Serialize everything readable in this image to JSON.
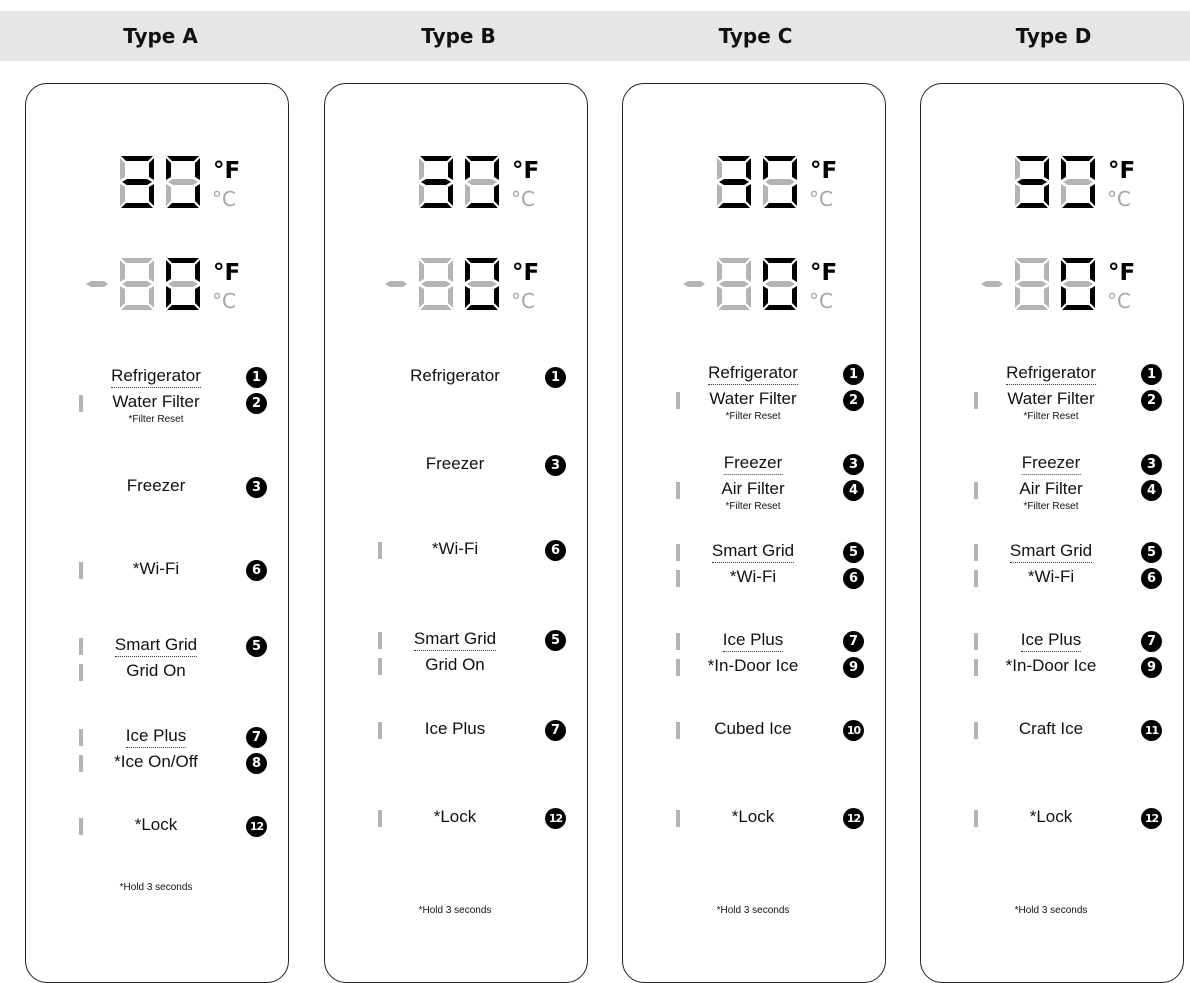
{
  "columns": [
    {
      "title": "Type A",
      "items": [
        {
          "label": "Refrigerator",
          "number": "1",
          "bar": false,
          "dotted": true,
          "row": 0
        },
        {
          "label": "Water Filter",
          "number": "2",
          "bar": true,
          "dotted": false,
          "row": 1,
          "sub": "*Filter Reset"
        },
        {
          "label": "Freezer",
          "number": "3",
          "bar": false,
          "dotted": false,
          "row": 2
        },
        {
          "label": "*Wi-Fi",
          "number": "6",
          "bar": true,
          "dotted": false,
          "row": 3
        },
        {
          "label": "Smart Grid",
          "number": "5",
          "bar": true,
          "dotted": true,
          "row": 4
        },
        {
          "label": "Grid On",
          "number": "",
          "bar": true,
          "dotted": false,
          "row": 5
        },
        {
          "label": "Ice Plus",
          "number": "7",
          "bar": true,
          "dotted": true,
          "row": 6
        },
        {
          "label": "*Ice On/Off",
          "number": "8",
          "bar": true,
          "dotted": false,
          "row": 7
        },
        {
          "label": "*Lock",
          "number": "12",
          "bar": true,
          "dotted": false,
          "row": 8
        }
      ],
      "note": "*Hold 3 seconds"
    },
    {
      "title": "Type B",
      "items": [
        {
          "label": "Refrigerator",
          "number": "1",
          "bar": false,
          "dotted": false,
          "row": 0
        },
        {
          "label": "Freezer",
          "number": "3",
          "bar": false,
          "dotted": false,
          "row": 2
        },
        {
          "label": "*Wi-Fi",
          "number": "6",
          "bar": true,
          "dotted": false,
          "row": 3
        },
        {
          "label": "Smart Grid",
          "number": "5",
          "bar": true,
          "dotted": true,
          "row": 4
        },
        {
          "label": "Grid On",
          "number": "",
          "bar": true,
          "dotted": false,
          "row": 5
        },
        {
          "label": "Ice Plus",
          "number": "7",
          "bar": true,
          "dotted": false,
          "row": 6
        },
        {
          "label": "*Lock",
          "number": "12",
          "bar": true,
          "dotted": false,
          "row": 8
        }
      ],
      "note": "*Hold 3 seconds"
    },
    {
      "title": "Type C",
      "items": [
        {
          "label": "Refrigerator",
          "number": "1",
          "bar": false,
          "dotted": true,
          "row": 0
        },
        {
          "label": "Water Filter",
          "number": "2",
          "bar": true,
          "dotted": false,
          "row": 1,
          "sub": "*Filter Reset"
        },
        {
          "label": "Freezer",
          "number": "3",
          "bar": false,
          "dotted": true,
          "row": 2
        },
        {
          "label": "Air Filter",
          "number": "4",
          "bar": true,
          "dotted": false,
          "row": 3,
          "sub": "*Filter Reset"
        },
        {
          "label": "Smart Grid",
          "number": "5",
          "bar": true,
          "dotted": true,
          "row": 4
        },
        {
          "label": "*Wi-Fi",
          "number": "6",
          "bar": true,
          "dotted": false,
          "row": 5
        },
        {
          "label": "Ice Plus",
          "number": "7",
          "bar": true,
          "dotted": true,
          "row": 6
        },
        {
          "label": "*In-Door Ice",
          "number": "9",
          "bar": true,
          "dotted": false,
          "row": 7
        },
        {
          "label": "Cubed Ice",
          "number": "10",
          "bar": true,
          "dotted": false,
          "row": 8
        },
        {
          "label": "*Lock",
          "number": "12",
          "bar": true,
          "dotted": false,
          "row": 9
        }
      ],
      "note": "*Hold 3 seconds"
    },
    {
      "title": "Type D",
      "items": [
        {
          "label": "Refrigerator",
          "number": "1",
          "bar": false,
          "dotted": true,
          "row": 0
        },
        {
          "label": "Water Filter",
          "number": "2",
          "bar": true,
          "dotted": false,
          "row": 1,
          "sub": "*Filter Reset"
        },
        {
          "label": "Freezer",
          "number": "3",
          "bar": false,
          "dotted": true,
          "row": 2
        },
        {
          "label": "Air Filter",
          "number": "4",
          "bar": true,
          "dotted": false,
          "row": 3,
          "sub": "*Filter Reset"
        },
        {
          "label": "Smart Grid",
          "number": "5",
          "bar": true,
          "dotted": true,
          "row": 4
        },
        {
          "label": "*Wi-Fi",
          "number": "6",
          "bar": true,
          "dotted": false,
          "row": 5
        },
        {
          "label": "Ice Plus",
          "number": "7",
          "bar": true,
          "dotted": true,
          "row": 6
        },
        {
          "label": "*In-Door Ice",
          "number": "9",
          "bar": true,
          "dotted": false,
          "row": 7
        },
        {
          "label": "Craft Ice",
          "number": "11",
          "bar": true,
          "dotted": false,
          "row": 8
        },
        {
          "label": "*Lock",
          "number": "12",
          "bar": true,
          "dotted": false,
          "row": 9
        }
      ],
      "note": "*Hold 3 seconds"
    }
  ],
  "display": {
    "unit_f": "°F",
    "unit_c": "°C",
    "segment_on_color": "#000000",
    "segment_off_color": "#b4b4b4",
    "bar_color": "#b4b4b4"
  },
  "colors": {
    "header_band": "#e6e6e6"
  }
}
